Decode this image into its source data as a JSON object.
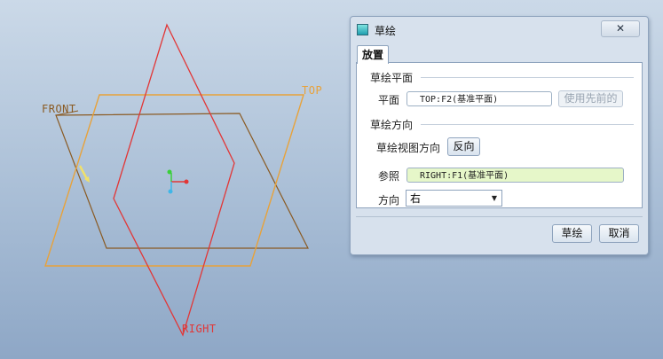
{
  "viewport": {
    "labels": {
      "top": "TOP",
      "front": "FRONT",
      "right": "RIGHT"
    },
    "colors": {
      "top_plane": "#e8a23a",
      "front_plane": "#8a5a22",
      "right_plane": "#e23636"
    }
  },
  "dialog": {
    "title": "草绘",
    "close_label": "Close",
    "tab": "放置",
    "section_plane": "草绘平面",
    "plane_label": "平面",
    "plane_value": "TOP:F2(基准平面)",
    "use_previous_button": "使用先前的",
    "section_orientation": "草绘方向",
    "view_direction_label": "草绘视图方向",
    "reverse_button": "反向",
    "reference_label": "参照",
    "reference_value": "RIGHT:F1(基准平面)",
    "direction_label": "方向",
    "direction_value": "右",
    "sketch_button": "草绘",
    "cancel_button": "取消"
  }
}
